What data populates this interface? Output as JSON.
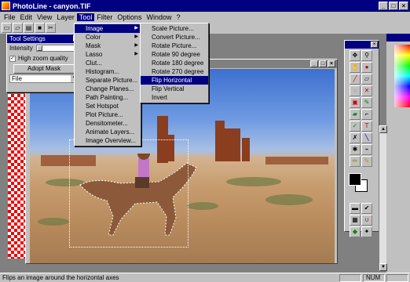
{
  "window": {
    "title": "PhotoLine - canyon.TIF",
    "controls": [
      "_",
      "□",
      "×"
    ]
  },
  "menubar": {
    "items": [
      "File",
      "Edit",
      "View",
      "Layer",
      "Tool",
      "Filter",
      "Options",
      "Window",
      "?"
    ],
    "active": "Tool"
  },
  "toolbar": {
    "icons": [
      "new-file-icon",
      "open-folder-icon",
      "print-icon",
      "save-icon",
      "cut-icon"
    ]
  },
  "tool_settings": {
    "title": "Tool Settings",
    "intensity_label": "Intensity",
    "high_zoom_label": "High zoom quality",
    "high_zoom_checked": true,
    "adopt_mask_label": "Adopt Mask",
    "select_value": "File"
  },
  "tool_menu": {
    "items": [
      {
        "label": "Image",
        "submenu": true,
        "selected": true
      },
      {
        "label": "Color",
        "submenu": true
      },
      {
        "label": "Mask",
        "submenu": true
      },
      {
        "label": "Lasso",
        "submenu": true
      },
      {
        "label": "Clut..."
      },
      {
        "label": "Histogram..."
      },
      {
        "label": "Separate Picture..."
      },
      {
        "label": "Change Planes..."
      },
      {
        "label": "Path Painting..."
      },
      {
        "label": "Set Hotspot"
      },
      {
        "label": "Plot Picture..."
      },
      {
        "label": "Densitometer..."
      },
      {
        "label": "Animate Layers..."
      },
      {
        "label": "Image Overview..."
      }
    ]
  },
  "image_menu": {
    "items": [
      {
        "label": "Scale Picture..."
      },
      {
        "label": "Convert Picture..."
      },
      {
        "label": "Rotate Picture..."
      },
      {
        "label": "Rotate 90 degree"
      },
      {
        "label": "Rotate 180 degree"
      },
      {
        "label": "Rotate 270 degree"
      },
      {
        "label": "Flip Horizontal",
        "selected": true
      },
      {
        "label": "Flip Vertical"
      },
      {
        "label": "Invert"
      }
    ]
  },
  "toolbox": {
    "tools": [
      "move-icon",
      "zoom-icon",
      "hand-icon",
      "shape-icon",
      "brush-icon",
      "eraser-icon",
      "lasso-icon",
      "wand-icon",
      "crop-icon",
      "pen-icon",
      "fill-icon",
      "dropper-icon",
      "check-icon",
      "text-icon",
      "stamp-icon",
      "line-icon",
      "blur-icon",
      "smudge-icon",
      "pencil-icon",
      "color-icon"
    ],
    "bottom_tools": [
      "layer-icon",
      "mask-icon",
      "grid-icon",
      "magnet-icon",
      "channel-icon",
      "pin-icon"
    ]
  },
  "statusbar": {
    "message": "Flips an image around the horizontal axes",
    "num": "NUM"
  }
}
